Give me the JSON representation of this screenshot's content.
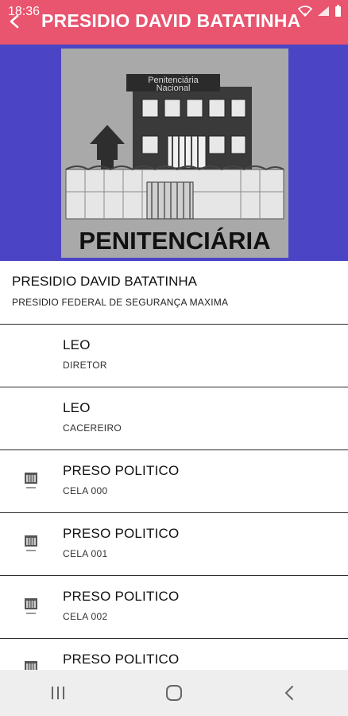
{
  "status_bar": {
    "time": "18:36",
    "icons": [
      "wifi-icon",
      "signal-icon",
      "battery-icon"
    ]
  },
  "app_bar": {
    "title": "PRESIDIO DAVID BATATINHA",
    "back_icon": "back-arrow-icon",
    "color": "#e9546e"
  },
  "hero": {
    "background_color": "#4b45c6",
    "sign_line1": "Penitenciária",
    "sign_line2": "Nacional",
    "caption": "PENITENCIÁRIA"
  },
  "header": {
    "title": "PRESIDIO DAVID BATATINHA",
    "subtitle": "PRESIDIO FEDERAL DE SEGURANÇA MAXIMA"
  },
  "list": [
    {
      "title": "LEO",
      "subtitle": "DIRETOR",
      "icon": ""
    },
    {
      "title": "LEO",
      "subtitle": "CACEREIRO",
      "icon": ""
    },
    {
      "title": "PRESO POLITICO",
      "subtitle": "CELA 000",
      "icon": "cell-icon"
    },
    {
      "title": "PRESO POLITICO",
      "subtitle": "CELA 001",
      "icon": "cell-icon"
    },
    {
      "title": "PRESO POLITICO",
      "subtitle": "CELA 002",
      "icon": "cell-icon"
    },
    {
      "title": "PRESO POLITICO",
      "subtitle": "",
      "icon": "cell-icon"
    }
  ],
  "nav_bar": {
    "buttons": [
      "recents-icon",
      "home-icon",
      "back-icon"
    ]
  }
}
